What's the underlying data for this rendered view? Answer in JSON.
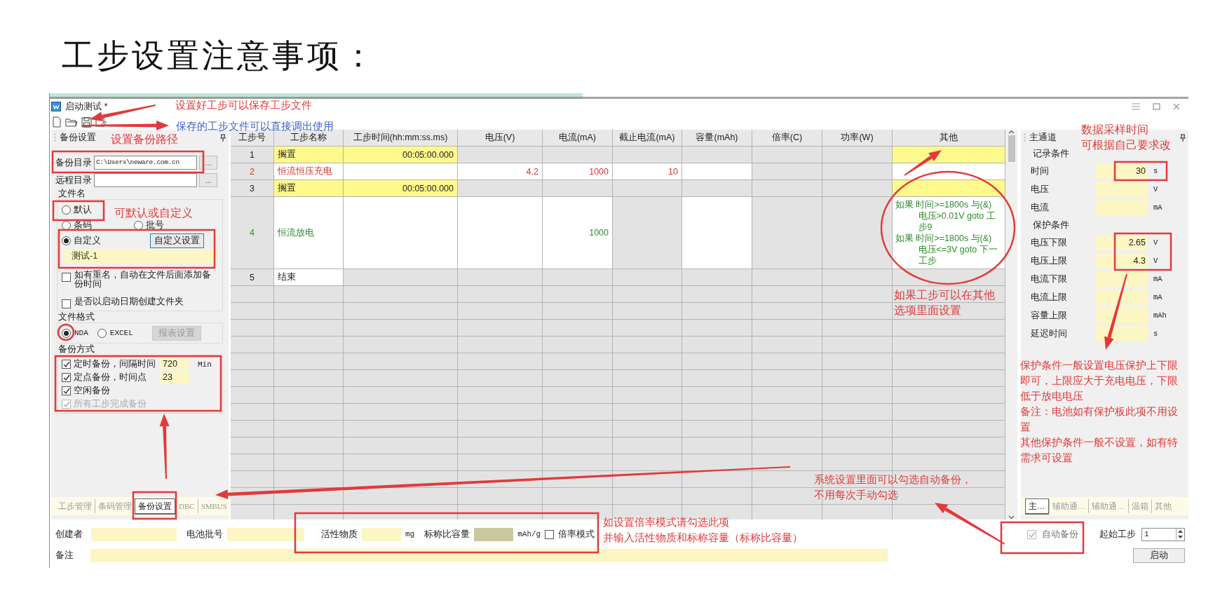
{
  "slide_title": "工步设置注意事项：",
  "window": {
    "title": "启动测试 *"
  },
  "backup_panel": {
    "title": "备份设置",
    "backup_dir": {
      "label": "备份目录",
      "value": "C:\\Users\\neware.com.cn",
      "browse": "..."
    },
    "remote_dir": {
      "label": "远程目录",
      "browse": "..."
    },
    "file_name": {
      "legend": "文件名",
      "options": [
        {
          "label": "默认",
          "selected": false
        },
        {
          "label": "条码",
          "selected": false
        },
        {
          "label": "批号",
          "selected": false
        },
        {
          "label": "自定义",
          "selected": true
        }
      ],
      "custom_button": "自定义设置",
      "custom_value": "测试-1",
      "checks": [
        {
          "label": "如有重名，自动在文件后面添加备份时间",
          "checked": false
        },
        {
          "label": "是否以启动日期创建文件夹",
          "checked": false
        }
      ]
    },
    "file_format": {
      "legend": "文件格式",
      "options": [
        {
          "label": "NDA",
          "selected": true
        },
        {
          "label": "EXCEL",
          "selected": false
        }
      ],
      "report_button": {
        "label": "报表设置",
        "disabled": true
      }
    },
    "backup_mode": {
      "legend": "备份方式",
      "items": [
        {
          "label": "定时备份，间隔时间",
          "checked": true,
          "disabled": false,
          "value": "720",
          "unit": "Min"
        },
        {
          "label": "定点备份，时间点",
          "checked": true,
          "disabled": false,
          "value": "23"
        },
        {
          "label": "空闲备份",
          "checked": true,
          "disabled": false
        },
        {
          "label": "所有工步完成备份",
          "checked": true,
          "disabled": true
        }
      ]
    },
    "tabs": [
      {
        "label": "工步管理",
        "selected": false
      },
      {
        "label": "条码管理",
        "selected": false
      },
      {
        "label": "备份设置",
        "selected": true
      },
      {
        "label": "DBC",
        "selected": false
      },
      {
        "label": "SMBUS",
        "selected": false
      }
    ]
  },
  "step_table": {
    "columns": [
      "工步号",
      "工步名称",
      "工步时间(hh:mm:ss.ms)",
      "电压(V)",
      "电流(mA)",
      "截止电流(mA)",
      "容量(mAh)",
      "倍率(C)",
      "功率(W)",
      "其他"
    ],
    "rows": [
      {
        "step": "1",
        "name": "搁置",
        "kind": "rest",
        "time": "00:05:00.000"
      },
      {
        "step": "2",
        "name": "恒流恒压充电",
        "kind": "charge",
        "voltage": "4.2",
        "current": "1000",
        "cutoff_current": "10"
      },
      {
        "step": "3",
        "name": "搁置",
        "kind": "rest",
        "time": "00:05:00.000"
      },
      {
        "step": "4",
        "name": "恒流放电",
        "kind": "discharge",
        "current": "1000",
        "other": [
          "如果 时间>=1800s 与(&) 电压>0.01V goto 工步9",
          "如果 时间>=1800s 与(&) 电压<=3V goto 下一工步"
        ]
      },
      {
        "step": "5",
        "name": "结束",
        "kind": "end"
      }
    ]
  },
  "channel_panel": {
    "title": "主通道",
    "sections": [
      {
        "label": "记录条件",
        "rows": [
          {
            "label": "时间",
            "value": "30",
            "unit": "s"
          },
          {
            "label": "电压",
            "unit": "V"
          },
          {
            "label": "电流",
            "unit": "mA"
          }
        ]
      },
      {
        "label": "保护条件",
        "rows": [
          {
            "label": "电压下限",
            "value": "2.65",
            "unit": "V"
          },
          {
            "label": "电压上限",
            "value": "4.3",
            "unit": "V"
          },
          {
            "label": "电流下限",
            "unit": "mA"
          },
          {
            "label": "电流上限",
            "unit": "mA"
          },
          {
            "label": "容量上限",
            "unit": "mAh"
          },
          {
            "label": "延迟时间",
            "unit": "s"
          }
        ]
      }
    ],
    "tabs": [
      {
        "label": "主…",
        "selected": true
      },
      {
        "label": "辅助通…",
        "selected": false
      },
      {
        "label": "辅助通…",
        "selected": false
      },
      {
        "label": "温箱",
        "selected": false
      },
      {
        "label": "其他",
        "selected": false
      }
    ]
  },
  "bottom": {
    "creator_label": "创建者",
    "batch_label": "电池批号",
    "active_material": {
      "label": "活性物质",
      "unit": "mg"
    },
    "nominal_capacity": {
      "label": "标称比容量",
      "unit": "mAh/g",
      "disabled": true
    },
    "rate_mode": {
      "label": "倍率模式",
      "checked": false
    },
    "note_label": "备注",
    "auto_backup": {
      "label": "自动备份",
      "checked": true,
      "disabled": true
    },
    "start_step": {
      "label": "起始工步",
      "value": "1"
    },
    "start_button": "启动"
  },
  "annotations": [
    {
      "lines": [
        "设置好工步可以保存工步文件"
      ],
      "color": "#e03a3a"
    },
    {
      "lines": [
        "保存的工步文件可以直接调出使用"
      ],
      "color": "#3d5fc4"
    },
    {
      "lines": [
        "设置备份路径"
      ],
      "color": "#e03a3a"
    },
    {
      "lines": [
        "可默认或自定义"
      ],
      "color": "#e03a3a"
    },
    {
      "lines": [
        "如果工步可以在其他",
        "选项里面设置"
      ],
      "color": "#e03a3a"
    },
    {
      "lines": [
        "数据采样时间",
        "可根据自己要求改"
      ],
      "color": "#e03a3a"
    },
    {
      "lines": [
        "保护条件一般设置电压保护上下限即可，上限应大于充电电压，下限低于放电电压",
        "备注：电池如有保护板此项不用设置",
        "其他保护条件一般不设置，如有特需求可设置"
      ],
      "color": "#e03a3a"
    },
    {
      "lines": [
        "系统设置里面可以勾选自动备份，",
        "不用每次手动勾选"
      ],
      "color": "#e03a3a"
    },
    {
      "lines": [
        "如设置倍率模式请勾选此项",
        "并输入活性物质和标称容量（标称比容量）"
      ],
      "color": "#e03a3a"
    }
  ]
}
